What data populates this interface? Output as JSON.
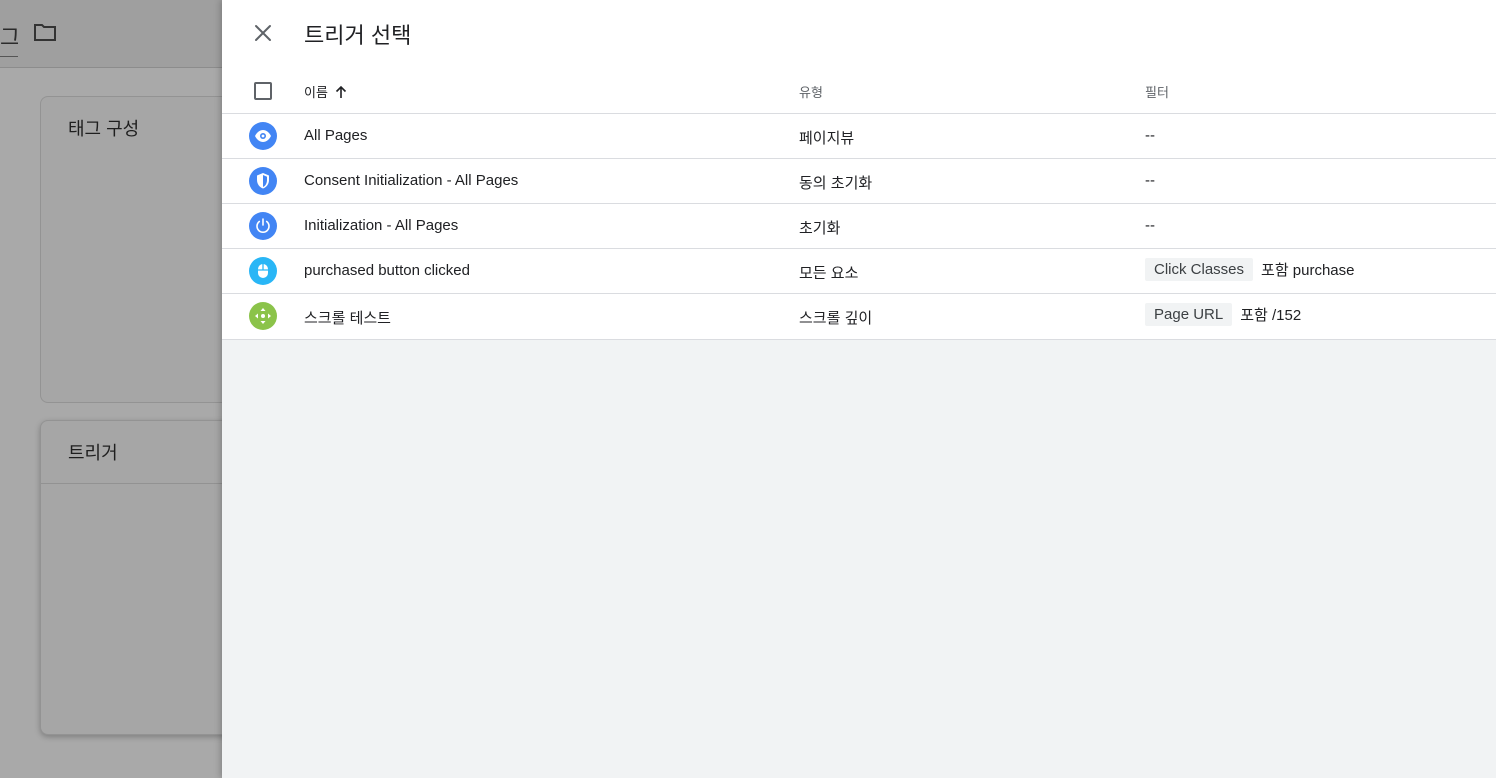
{
  "background": {
    "breadcrumb_fragment": "그",
    "tag_card_title": "태그 구성",
    "trigger_card_title": "트리거"
  },
  "drawer": {
    "title": "트리거 선택",
    "columns": {
      "name": "이름",
      "type": "유형",
      "filter": "필터"
    },
    "rows": [
      {
        "name": "All Pages",
        "type": "페이지뷰",
        "filter_text": "--",
        "icon": "eye-icon",
        "color": "#4285f4"
      },
      {
        "name": "Consent Initialization - All Pages",
        "type": "동의 초기화",
        "filter_text": "--",
        "icon": "shield-icon",
        "color": "#4285f4"
      },
      {
        "name": "Initialization - All Pages",
        "type": "초기화",
        "filter_text": "--",
        "icon": "power-icon",
        "color": "#4285f4"
      },
      {
        "name": "purchased button clicked",
        "type": "모든 요소",
        "filter_chip": "Click Classes",
        "filter_text": "포함 purchase",
        "icon": "mouse-icon",
        "color": "#29b6f6"
      },
      {
        "name": "스크롤 테스트",
        "type": "스크롤 깊이",
        "filter_chip": "Page URL",
        "filter_text": "포함 /152",
        "icon": "move-arrows-icon",
        "color": "#8bc34a"
      }
    ]
  }
}
